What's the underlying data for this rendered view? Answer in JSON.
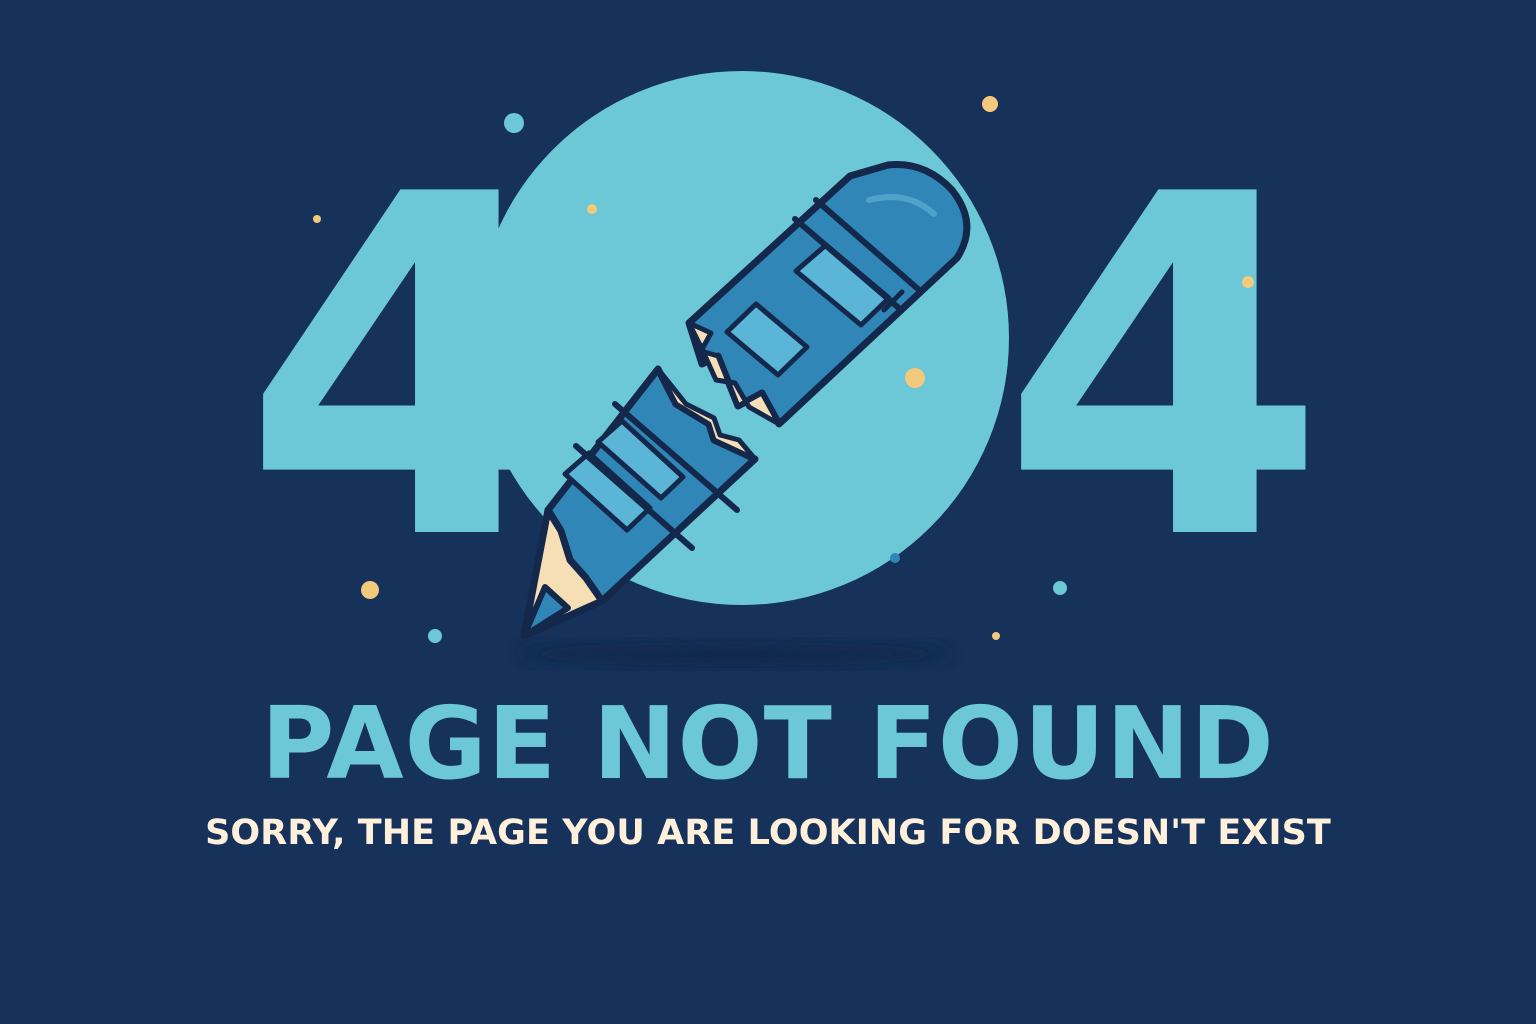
{
  "error_page": {
    "code_left": "4",
    "code_right": "4",
    "title": "PAGE NOT FOUND",
    "message": "SORRY, THE PAGE YOU ARE LOOKING FOR DOESN'T EXIST"
  },
  "icons": {
    "broken_pencil": "broken-pencil-icon",
    "circle_zero": "zero-circle-icon"
  },
  "colors": {
    "background": "#16315a",
    "primary": "#6cc7d6",
    "accent": "#f3c97c",
    "pencil_blue": "#2f86b7",
    "pencil_light": "#5ab5d6",
    "pencil_wood": "#f7dfb5",
    "outline": "#13284b",
    "text_light": "#fff0dc"
  }
}
